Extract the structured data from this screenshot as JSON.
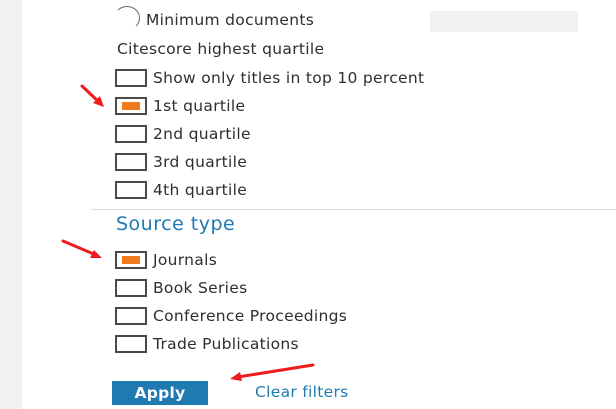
{
  "filters": {
    "minimum_documents": {
      "label": "Minimum documents",
      "value": ""
    },
    "citescore_quartile": {
      "heading": "Citescore highest quartile",
      "options": [
        {
          "label": "Show only titles in top 10 percent",
          "checked": false
        },
        {
          "label": "1st quartile",
          "checked": true
        },
        {
          "label": "2nd quartile",
          "checked": false
        },
        {
          "label": "3rd quartile",
          "checked": false
        },
        {
          "label": "4th quartile",
          "checked": false
        }
      ]
    },
    "source_type": {
      "heading": "Source type",
      "options": [
        {
          "label": "Journals",
          "checked": true
        },
        {
          "label": "Book Series",
          "checked": false
        },
        {
          "label": "Conference Proceedings",
          "checked": false
        },
        {
          "label": "Trade Publications",
          "checked": false
        }
      ]
    }
  },
  "actions": {
    "apply_label": "Apply",
    "clear_label": "Clear filters"
  },
  "colors": {
    "accent_blue": "#1f7ab2",
    "check_orange": "#f27a1a",
    "annotation_red": "#ee1c1c"
  }
}
